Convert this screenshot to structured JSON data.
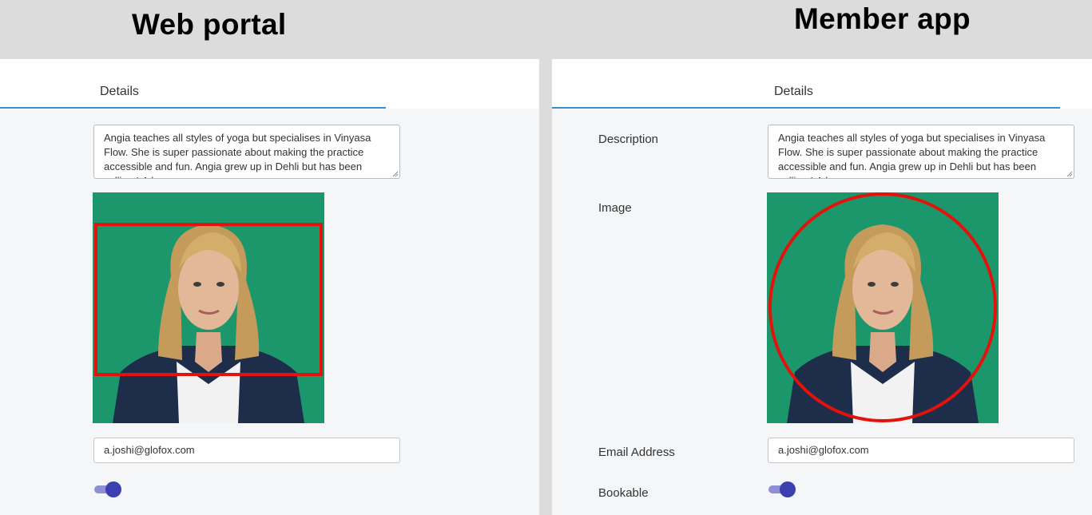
{
  "headings": {
    "left": "Web portal",
    "right": "Member app"
  },
  "web_portal": {
    "tab": "Details",
    "description": "Angia teaches all styles of yoga but specialises in Vinyasa Flow. She is super passionate about making the practice accessible and fun. Angia grew up in Dehli but has been calling LA her",
    "email": "a.joshi@glofox.com",
    "bookable_on": true
  },
  "member_app": {
    "tab": "Details",
    "labels": {
      "description": "Description",
      "image": "Image",
      "email": "Email Address",
      "bookable": "Bookable"
    },
    "description": "Angia teaches all styles of yoga but specialises in Vinyasa Flow. She is super passionate about making the practice accessible and fun. Angia grew up in Dehli but has been calling LA her",
    "email": "a.joshi@glofox.com",
    "bookable_on": true
  },
  "colors": {
    "photo_background": "#1c976b",
    "highlight": "#e3120b",
    "accent_underline": "#3a8fc7",
    "toggle": "#3b3fb0"
  }
}
